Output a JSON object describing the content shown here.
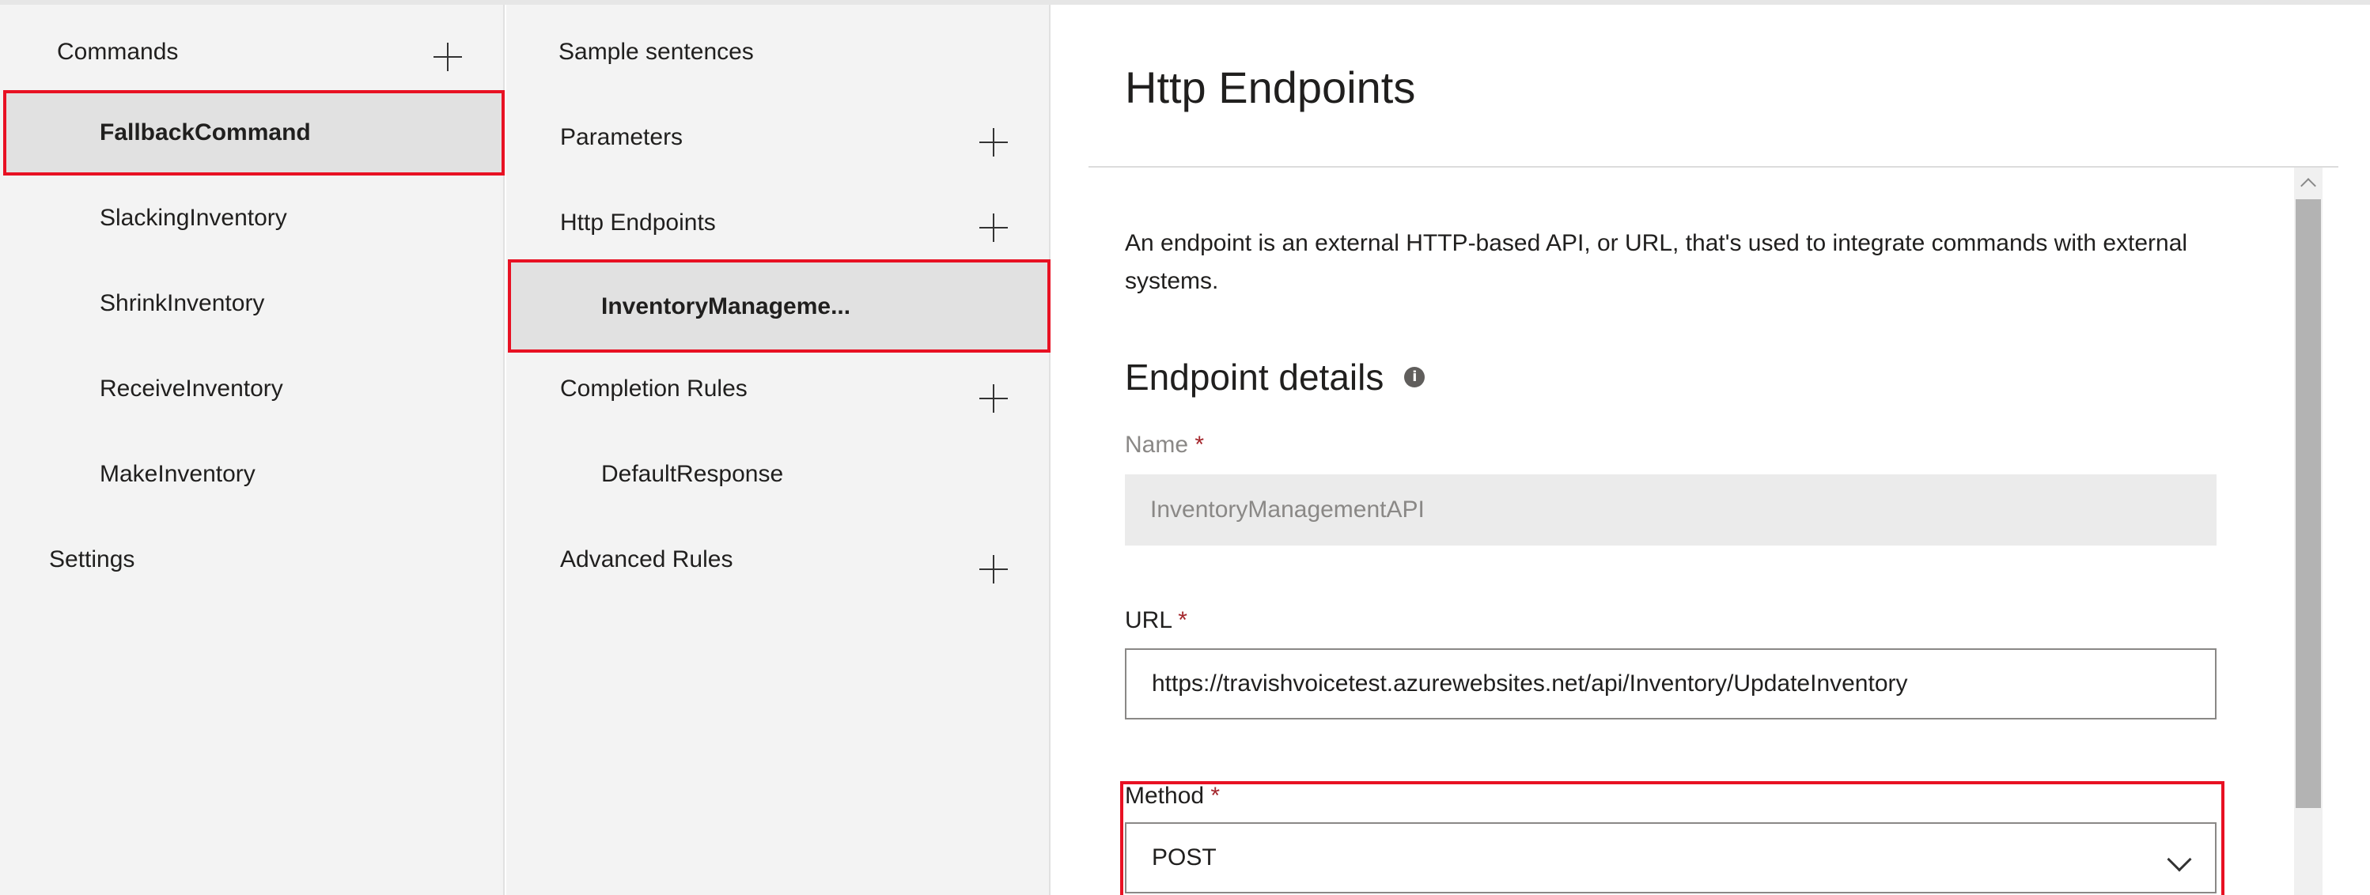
{
  "left_panel": {
    "commands_label": "Commands",
    "commands": [
      {
        "label": "FallbackCommand",
        "selected": true
      },
      {
        "label": "SlackingInventory"
      },
      {
        "label": "ShrinkInventory"
      },
      {
        "label": "ReceiveInventory"
      },
      {
        "label": "MakeInventory"
      }
    ],
    "settings_label": "Settings"
  },
  "middle_panel": {
    "sample_sentences": "Sample sentences",
    "parameters": "Parameters",
    "http_endpoints": "Http Endpoints",
    "endpoint_item": "InventoryManageme...",
    "completion_rules": "Completion Rules",
    "default_response": "DefaultResponse",
    "advanced_rules": "Advanced Rules"
  },
  "detail": {
    "title": "Http Endpoints",
    "description": "An endpoint is an external HTTP-based API, or URL, that's used to integrate commands with external systems.",
    "section_title": "Endpoint details",
    "info_glyph": "i",
    "name_label": "Name",
    "name_value": "InventoryManagementAPI",
    "url_label": "URL",
    "url_value": "https://travishvoicetest.azurewebsites.net/api/Inventory/UpdateInventory",
    "method_label": "Method",
    "method_value": "POST",
    "required_marker": "*"
  },
  "colors": {
    "highlight_border": "#e81123",
    "panel_bg": "#f3f3f3",
    "selected_bg": "#e1e1e1"
  }
}
